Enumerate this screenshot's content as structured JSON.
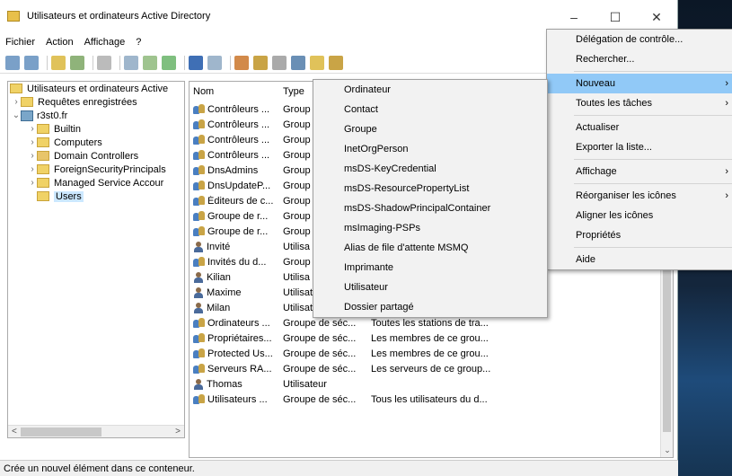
{
  "window": {
    "title": "Utilisateurs et ordinateurs Active Directory",
    "controls": {
      "minimize": "–",
      "maximize": "☐",
      "close": "✕"
    }
  },
  "menubar": [
    "Fichier",
    "Action",
    "Affichage",
    "?"
  ],
  "tree": {
    "root": "Utilisateurs et ordinateurs Active",
    "items": [
      {
        "label": "Requêtes enregistrées",
        "chev": "›",
        "indent": 1
      },
      {
        "label": "r3st0.fr",
        "chev": "⌄",
        "indent": 0
      },
      {
        "label": "Builtin",
        "chev": "›",
        "indent": 2
      },
      {
        "label": "Computers",
        "chev": "›",
        "indent": 2
      },
      {
        "label": "Domain Controllers",
        "chev": "›",
        "indent": 2
      },
      {
        "label": "ForeignSecurityPrincipals",
        "chev": "›",
        "indent": 2
      },
      {
        "label": "Managed Service Accour",
        "chev": "›",
        "indent": 2
      },
      {
        "label": "Users",
        "chev": "",
        "indent": 2,
        "selected": true
      }
    ]
  },
  "list": {
    "headers": {
      "name": "Nom",
      "type": "Type"
    },
    "rows": [
      {
        "icon": "group",
        "name": "Contrôleurs ...",
        "type": "Group",
        "desc": ""
      },
      {
        "icon": "group",
        "name": "Contrôleurs ...",
        "type": "Group",
        "desc": ""
      },
      {
        "icon": "group",
        "name": "Contrôleurs ...",
        "type": "Group",
        "desc": ""
      },
      {
        "icon": "group",
        "name": "Contrôleurs ...",
        "type": "Group",
        "desc": ""
      },
      {
        "icon": "group",
        "name": "DnsAdmins",
        "type": "Group",
        "desc": ""
      },
      {
        "icon": "group",
        "name": "DnsUpdateP...",
        "type": "Group",
        "desc": ""
      },
      {
        "icon": "group",
        "name": "Éditeurs de c...",
        "type": "Group",
        "desc": ""
      },
      {
        "icon": "group",
        "name": "Groupe de r...",
        "type": "Group",
        "desc": ""
      },
      {
        "icon": "group",
        "name": "Groupe de r...",
        "type": "Group",
        "desc": ""
      },
      {
        "icon": "user",
        "name": "Invité",
        "type": "Utilisa",
        "desc": ""
      },
      {
        "icon": "group",
        "name": "Invités du d...",
        "type": "Group",
        "desc": ""
      },
      {
        "icon": "user",
        "name": "Kilian",
        "type": "Utilisa",
        "desc": ""
      },
      {
        "icon": "user",
        "name": "Maxime",
        "type": "Utilisateur",
        "desc": ""
      },
      {
        "icon": "user",
        "name": "Milan",
        "type": "Utilisateur",
        "desc": ""
      },
      {
        "icon": "group",
        "name": "Ordinateurs ...",
        "type": "Groupe de séc...",
        "desc": "Toutes les stations de tra..."
      },
      {
        "icon": "group",
        "name": "Propriétaires...",
        "type": "Groupe de séc...",
        "desc": "Les membres de ce grou..."
      },
      {
        "icon": "group",
        "name": "Protected Us...",
        "type": "Groupe de séc...",
        "desc": "Les membres de ce grou..."
      },
      {
        "icon": "group",
        "name": "Serveurs RA...",
        "type": "Groupe de séc...",
        "desc": "Les serveurs de ce group..."
      },
      {
        "icon": "user",
        "name": "Thomas",
        "type": "Utilisateur",
        "desc": ""
      },
      {
        "icon": "group",
        "name": "Utilisateurs ...",
        "type": "Groupe de séc...",
        "desc": "Tous les utilisateurs du d..."
      }
    ]
  },
  "status": "Crée un nouvel élément dans ce conteneur.",
  "context_menu": {
    "items": [
      {
        "label": "Délégation de contrôle...",
        "sub": ""
      },
      {
        "label": "Rechercher...",
        "sub": ""
      },
      {
        "sep": true
      },
      {
        "label": "Nouveau",
        "sub": "›",
        "highlight": true
      },
      {
        "label": "Toutes les tâches",
        "sub": "›"
      },
      {
        "sep": true
      },
      {
        "label": "Actualiser",
        "sub": ""
      },
      {
        "label": "Exporter la liste...",
        "sub": ""
      },
      {
        "sep": true
      },
      {
        "label": "Affichage",
        "sub": "›"
      },
      {
        "sep": true
      },
      {
        "label": "Réorganiser les icônes",
        "sub": "›"
      },
      {
        "label": "Aligner les icônes",
        "sub": ""
      },
      {
        "label": "Propriétés",
        "sub": ""
      },
      {
        "sep": true
      },
      {
        "label": "Aide",
        "sub": ""
      }
    ]
  },
  "new_submenu": {
    "items": [
      "Ordinateur",
      "Contact",
      "Groupe",
      "InetOrgPerson",
      "msDS-KeyCredential",
      "msDS-ResourcePropertyList",
      "msDS-ShadowPrincipalContainer",
      "msImaging-PSPs",
      "Alias de file d'attente MSMQ",
      "Imprimante",
      "Utilisateur",
      "Dossier partagé"
    ]
  },
  "colors": {
    "highlight": "#91c9f7",
    "selection": "#cce8ff"
  }
}
